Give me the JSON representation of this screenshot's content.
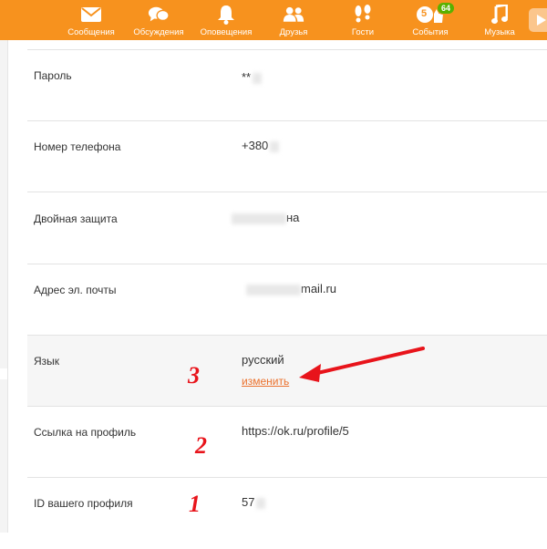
{
  "nav": {
    "items": [
      {
        "label": "Сообщения",
        "icon": "envelope-icon"
      },
      {
        "label": "Обсуждения",
        "icon": "chat-bubbles-icon"
      },
      {
        "label": "Оповещения",
        "icon": "bell-icon"
      },
      {
        "label": "Друзья",
        "icon": "people-icon"
      },
      {
        "label": "Гости",
        "icon": "footprints-icon"
      },
      {
        "label": "События",
        "icon": "like-icon",
        "badge": "64",
        "count": "5"
      },
      {
        "label": "Музыка",
        "icon": "music-note-icon"
      }
    ]
  },
  "settings": {
    "rows": [
      {
        "label": "Пароль",
        "value": "**"
      },
      {
        "label": "Номер телефона",
        "value": "+380"
      },
      {
        "label": "Двойная защита",
        "value": "на"
      },
      {
        "label": "Адрес эл. почты",
        "value": "mail.ru"
      },
      {
        "label": "Язык",
        "value": "русский",
        "link": "изменить"
      },
      {
        "label": "Ссылка на профиль",
        "value": "https://ok.ru/profile/5"
      },
      {
        "label": "ID вашего профиля",
        "value": "57"
      }
    ]
  },
  "annotations": {
    "marker_1": "1",
    "marker_2": "2",
    "marker_3": "3"
  },
  "colors": {
    "topbar": "#f7921e",
    "link": "#eb722e",
    "annotation": "#e8141b",
    "badge": "#59b100"
  }
}
